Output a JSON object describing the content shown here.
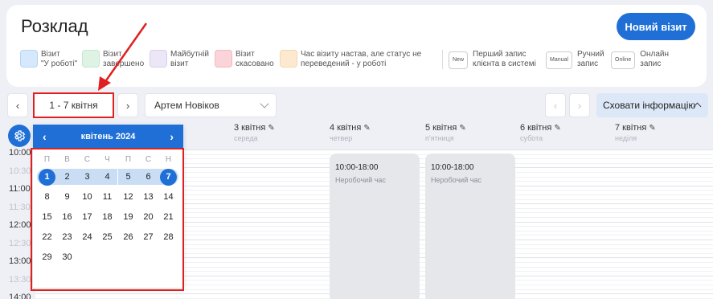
{
  "header": {
    "title": "Розклад",
    "new_visit": "Новий візит"
  },
  "legend": [
    {
      "label": "Візит\n\"У роботі\"",
      "color": "#d6e8fb"
    },
    {
      "label": "Візит\nзавершено",
      "color": "#dff3e4"
    },
    {
      "label": "Майбутній\nвізит",
      "color": "#ece6f6"
    },
    {
      "label": "Візит\nскасовано",
      "color": "#fbd4d9"
    },
    {
      "label": "Час візиту настав, але статус не\nпереведений - у роботі",
      "color": "#fde9cf"
    }
  ],
  "tags": [
    {
      "tag": "New",
      "label": "Перший запис\nклієнта в системі"
    },
    {
      "tag": "Manual",
      "label": "Ручний\nзапис"
    },
    {
      "tag": "Online",
      "label": "Онлайн\nзапис"
    }
  ],
  "toolbar": {
    "prev": "‹",
    "next": "›",
    "date_range": "1 - 7 квітня",
    "employee": "Артем Новіков",
    "hide_info": "Сховати інформацію"
  },
  "days": [
    {
      "date": "3 квітня",
      "weekday": "середа"
    },
    {
      "date": "4 квітня",
      "weekday": "четвер"
    },
    {
      "date": "5 квітня",
      "weekday": "п'ятниця"
    },
    {
      "date": "6 квітня",
      "weekday": "субота"
    },
    {
      "date": "7 квітня",
      "weekday": "неділя"
    }
  ],
  "times": [
    "10:00",
    "10:30",
    "11:00",
    "11:30",
    "12:00",
    "12:30",
    "13:00",
    "13:30",
    "14:00"
  ],
  "blocks": [
    {
      "time": "10:00-18:00",
      "label": "Неробочий час"
    },
    {
      "time": "10:00-18:00",
      "label": "Неробочий час"
    }
  ],
  "calendar": {
    "month": "квітень 2024",
    "weekdays": [
      "П",
      "В",
      "С",
      "Ч",
      "П",
      "С",
      "Н"
    ],
    "weeks": [
      [
        "1",
        "2",
        "3",
        "4",
        "5",
        "6",
        "7"
      ],
      [
        "8",
        "9",
        "10",
        "11",
        "12",
        "13",
        "14"
      ],
      [
        "15",
        "16",
        "17",
        "18",
        "19",
        "20",
        "21"
      ],
      [
        "22",
        "23",
        "24",
        "25",
        "26",
        "27",
        "28"
      ],
      [
        "29",
        "30",
        "",
        "",
        "",
        "",
        ""
      ]
    ],
    "range_start": "1",
    "range_end": "7"
  },
  "colors": {
    "accent": "#1f6fd6",
    "highlight": "#e02020",
    "range": "#c9def5"
  }
}
